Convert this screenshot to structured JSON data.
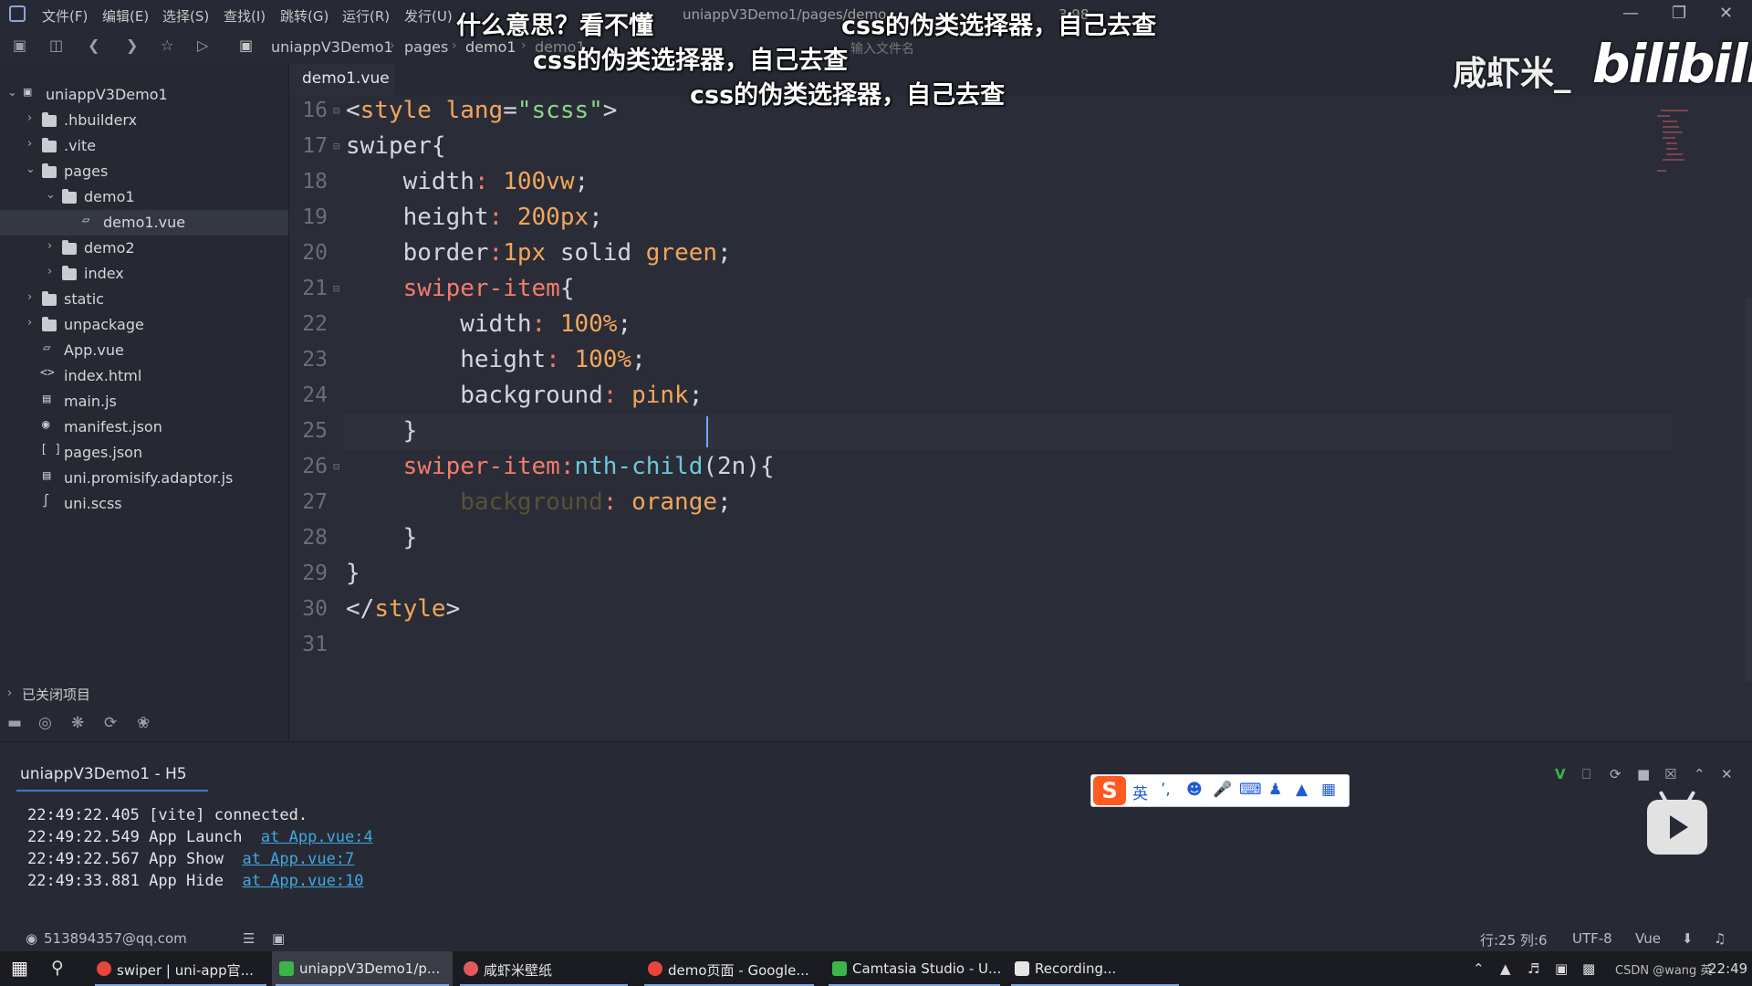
{
  "menubar": {
    "items": [
      "文件(F)",
      "编辑(E)",
      "选择(S)",
      "查找(I)",
      "跳转(G)",
      "运行(R)",
      "发行(U)"
    ],
    "title_fragment": "uniappV3Demo1/pages/demo",
    "version_fragment": "3.98"
  },
  "toolbar": {
    "breadcrumb": [
      "uniappV3Demo1",
      "pages",
      "demo1",
      "demo1"
    ],
    "file_search_placeholder": "输入文件名"
  },
  "sidebar": {
    "items": [
      {
        "label": "uniappV3Demo1",
        "type": "project",
        "expanded": true
      },
      {
        "label": ".hbuilderx",
        "type": "folder",
        "expanded": false
      },
      {
        "label": ".vite",
        "type": "folder",
        "expanded": false
      },
      {
        "label": "pages",
        "type": "folder",
        "expanded": true
      },
      {
        "label": "demo1",
        "type": "folder",
        "expanded": true
      },
      {
        "label": "demo1.vue",
        "type": "vue",
        "selected": true
      },
      {
        "label": "demo2",
        "type": "folder",
        "expanded": false
      },
      {
        "label": "index",
        "type": "folder",
        "expanded": false
      },
      {
        "label": "static",
        "type": "folder",
        "expanded": false
      },
      {
        "label": "unpackage",
        "type": "folder",
        "expanded": false
      },
      {
        "label": "App.vue",
        "type": "vue"
      },
      {
        "label": "index.html",
        "type": "html"
      },
      {
        "label": "main.js",
        "type": "js"
      },
      {
        "label": "manifest.json",
        "type": "manifest"
      },
      {
        "label": "pages.json",
        "type": "json"
      },
      {
        "label": "uni.promisify.adaptor.js",
        "type": "js"
      },
      {
        "label": "uni.scss",
        "type": "scss"
      }
    ],
    "closed_projects_label": "已关闭项目"
  },
  "editor": {
    "tab_label": "demo1.vue",
    "lines": [
      {
        "n": "16",
        "text": "<style lang=\"scss\">"
      },
      {
        "n": "17",
        "text": "swiper{"
      },
      {
        "n": "18",
        "text": "    width: 100vw;"
      },
      {
        "n": "19",
        "text": "    height: 200px;"
      },
      {
        "n": "20",
        "text": "    border:1px solid green;"
      },
      {
        "n": "21",
        "text": "    swiper-item{"
      },
      {
        "n": "22",
        "text": "        width: 100%;"
      },
      {
        "n": "23",
        "text": "        height: 100%;"
      },
      {
        "n": "24",
        "text": "        background: pink;"
      },
      {
        "n": "25",
        "text": "    }"
      },
      {
        "n": "26",
        "text": "    swiper-item:nth-child(2n){"
      },
      {
        "n": "27",
        "text": "        background: orange;"
      },
      {
        "n": "28",
        "text": "    }"
      },
      {
        "n": "29",
        "text": "}"
      },
      {
        "n": "30",
        "text": "</style>"
      },
      {
        "n": "31",
        "text": ""
      }
    ]
  },
  "console": {
    "tab_label": "uniappV3Demo1 - H5",
    "logs": [
      {
        "time": "22:49:22.405",
        "msg": "[vite] connected.",
        "link": ""
      },
      {
        "time": "22:49:22.549",
        "msg": "App Launch",
        "link": "at App.vue:4"
      },
      {
        "time": "22:49:22.567",
        "msg": "App Show",
        "link": "at App.vue:7"
      },
      {
        "time": "22:49:33.881",
        "msg": "App Hide",
        "link": "at App.vue:10"
      }
    ]
  },
  "statusbar": {
    "account": "513894357@qq.com",
    "position": "行:25  列:6",
    "encoding": "UTF-8",
    "language": "Vue"
  },
  "taskbar": {
    "tasks": [
      {
        "label": "swiper | uni-app官...",
        "color": "#e8453c"
      },
      {
        "label": "uniappV3Demo1/p...",
        "color": "#3bb54a"
      },
      {
        "label": "咸虾米壁纸",
        "color": "#e05a5a"
      },
      {
        "label": "demo页面 - Google...",
        "color": "#e8453c"
      },
      {
        "label": "Camtasia Studio - U...",
        "color": "#3bb54a"
      },
      {
        "label": "Recording...",
        "color": "#e6e6e6"
      }
    ],
    "clock": "22:49",
    "tray_text": "CSDN @wang 英"
  },
  "overlay": {
    "subtitles": [
      "什么意思？看不懂",
      "css的伪类选择器，自己去查",
      "css的伪类选择器，自己去查",
      "css的伪类选择器，自己去查"
    ],
    "uploader": "咸虾米_",
    "logo": "bilibili"
  },
  "ime": {
    "lang": "英"
  }
}
